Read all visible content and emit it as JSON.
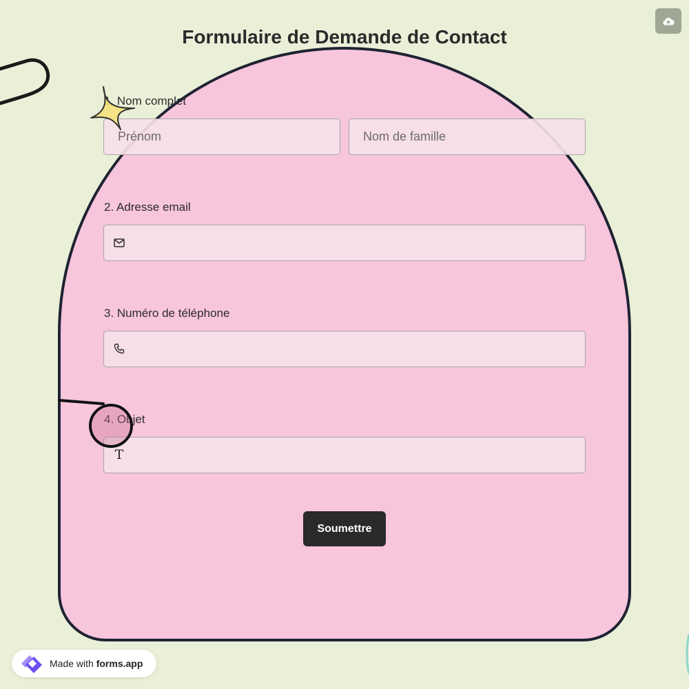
{
  "page": {
    "title": "Formulaire de Demande de Contact"
  },
  "toolbar": {
    "upload_icon": "cloud-upload-icon"
  },
  "form": {
    "questions": [
      {
        "label": "1. Nom complet",
        "fields": [
          {
            "placeholder": "Prénom",
            "value": ""
          },
          {
            "placeholder": "Nom de famille",
            "value": ""
          }
        ]
      },
      {
        "label": "2. Adresse email",
        "icon": "envelope-icon",
        "value": ""
      },
      {
        "label": "3. Numéro de téléphone",
        "icon": "phone-icon",
        "value": ""
      },
      {
        "label": "4. Objet",
        "icon": "text-icon",
        "icon_glyph": "T",
        "value": ""
      }
    ],
    "submit_label": "Soumettre"
  },
  "badge": {
    "prefix": "Made with",
    "brand": "forms.app"
  },
  "colors": {
    "background": "#eaf0d8",
    "arch_fill": "#f7c5dc",
    "arch_border": "#1f2333",
    "button": "#2a2a2a",
    "star": "#f6e27a",
    "logo_purple": "#7b5cf0"
  }
}
